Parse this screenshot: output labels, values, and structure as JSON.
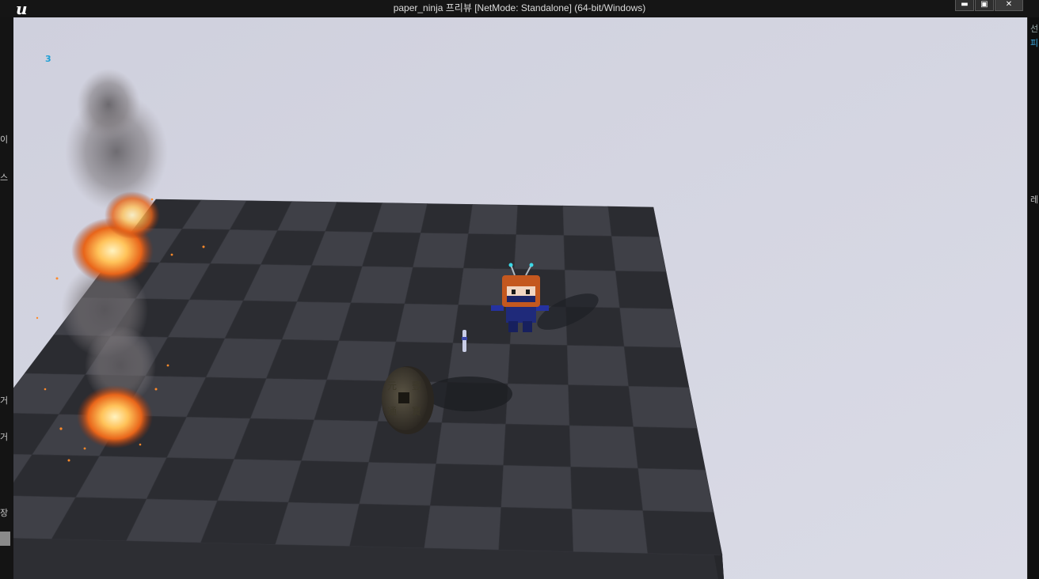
{
  "window": {
    "title": "paper_ninja 프리뷰 [NetMode: Standalone]  (64-bit/Windows)",
    "logo_glyph": "u",
    "logo_icon": "unreal-engine-logo-icon",
    "minimize_glyph": "▬",
    "maximize_glyph": "▣",
    "close_glyph": "✕"
  },
  "editor_behind": {
    "left_fragments": [
      "이",
      "스",
      "거",
      "거",
      "장"
    ],
    "right_fragments": [
      "선",
      "피",
      "레"
    ]
  },
  "hud": {
    "counter": "3"
  },
  "scene_objects": [
    "fire-emitter",
    "ninja-character",
    "shuriken-pickup",
    "coin-pickup",
    "checkered-floor"
  ],
  "colors": {
    "sky": "#d3d4e1",
    "floor_dark": "#2b2c31",
    "floor_light": "#3f4047",
    "hud_text": "#1e9fd6",
    "ninja_head": "#c4581f",
    "ninja_body": "#1f2a7a"
  }
}
